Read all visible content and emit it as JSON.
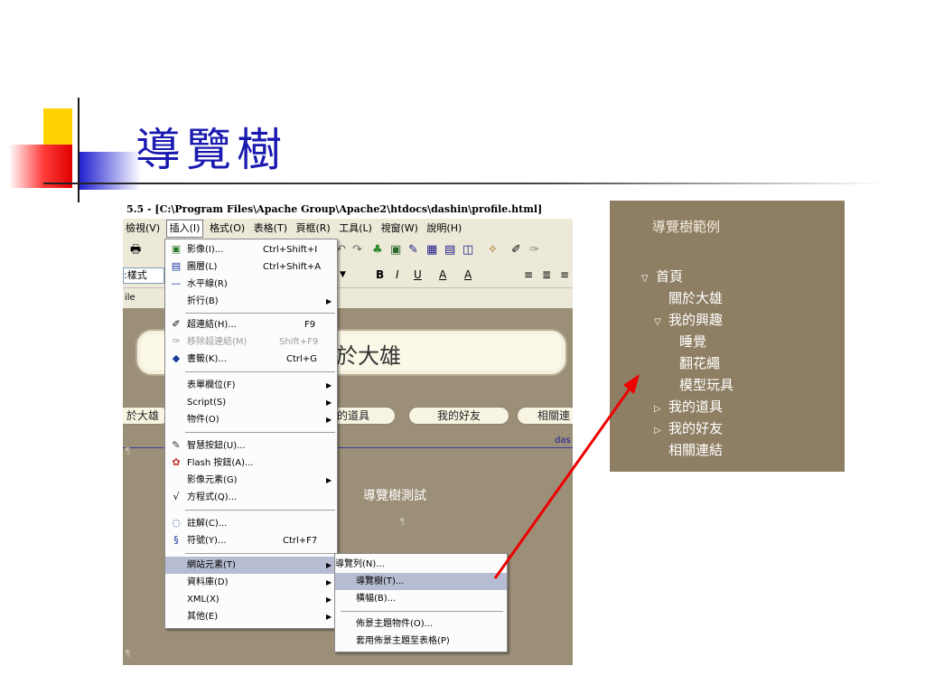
{
  "slide": {
    "title": "導覽樹"
  },
  "editor": {
    "window_title": "5.5 - [C:\\Program Files\\Apache Group\\Apache2\\htdocs\\dashin\\profile.html]",
    "menubar": [
      "檢視(V)",
      "插入(I)",
      "格式(O)",
      "表格(T)",
      "頁框(R)",
      "工具(L)",
      "視窗(W)",
      "說明(H)"
    ],
    "active_menu": "插入(I)",
    "style_box": ":樣式",
    "file_tab": "ile",
    "banner_text": "於大雄",
    "nav_buttons": [
      "於大雄",
      "我的道具",
      "我的好友",
      "相關連"
    ],
    "link_fragment": "das",
    "test_text": "導覽樹測試",
    "format_buttons": [
      "B",
      "I",
      "U",
      "A",
      "A"
    ]
  },
  "insert_menu": {
    "items": [
      {
        "label": "影像(I)...",
        "shortcut": "Ctrl+Shift+I",
        "icon": "image-icon"
      },
      {
        "label": "圖層(L)",
        "shortcut": "Ctrl+Shift+A",
        "icon": "layer-icon"
      },
      {
        "label": "水平線(R)",
        "shortcut": "",
        "icon": "horizontal-line-icon"
      },
      {
        "label": "折行(B)",
        "shortcut": "",
        "icon": ""
      },
      {
        "label": "超連結(H)...",
        "shortcut": "F9",
        "icon": "hyperlink-icon"
      },
      {
        "label": "移除超連結(M)",
        "shortcut": "Shift+F9",
        "icon": "unlink-icon"
      },
      {
        "label": "書籤(K)...",
        "shortcut": "Ctrl+G",
        "icon": "bookmark-icon"
      },
      {
        "label": "表單欄位(F)",
        "shortcut": "",
        "icon": ""
      },
      {
        "label": "Script(S)",
        "shortcut": "",
        "icon": ""
      },
      {
        "label": "物件(O)",
        "shortcut": "",
        "icon": ""
      },
      {
        "label": "智慧按鈕(U)...",
        "shortcut": "",
        "icon": "smart-button-icon"
      },
      {
        "label": "Flash 按鈕(A)...",
        "shortcut": "",
        "icon": "flash-button-icon"
      },
      {
        "label": "影像元素(G)",
        "shortcut": "",
        "icon": ""
      },
      {
        "label": "方程式(Q)...",
        "shortcut": "",
        "icon": "equation-icon"
      },
      {
        "label": "註解(C)...",
        "shortcut": "",
        "icon": "comment-icon"
      },
      {
        "label": "符號(Y)...",
        "shortcut": "Ctrl+F7",
        "icon": "symbol-icon"
      },
      {
        "label": "網站元素(T)",
        "shortcut": "",
        "icon": ""
      },
      {
        "label": "資料庫(D)",
        "shortcut": "",
        "icon": ""
      },
      {
        "label": "XML(X)",
        "shortcut": "",
        "icon": ""
      },
      {
        "label": "其他(E)",
        "shortcut": "",
        "icon": ""
      }
    ]
  },
  "web_components_menu": {
    "items": [
      "導覽列(N)...",
      "導覽樹(T)...",
      "橫幅(B)...",
      "佈景主題物件(O)...",
      "套用佈景主題至表格(P)"
    ]
  },
  "tree_example": {
    "title": "導覽樹範例",
    "nodes": [
      "首頁",
      "關於大雄",
      "我的興趣",
      "睡覺",
      "翻花繩",
      "模型玩具",
      "我的道具",
      "我的好友",
      "相關連結"
    ]
  },
  "colors": {
    "panel_bg": "#8e7e63",
    "highlight": "#b6bdd2",
    "arrow": "#ee0000",
    "title": "#1a1ab0"
  }
}
